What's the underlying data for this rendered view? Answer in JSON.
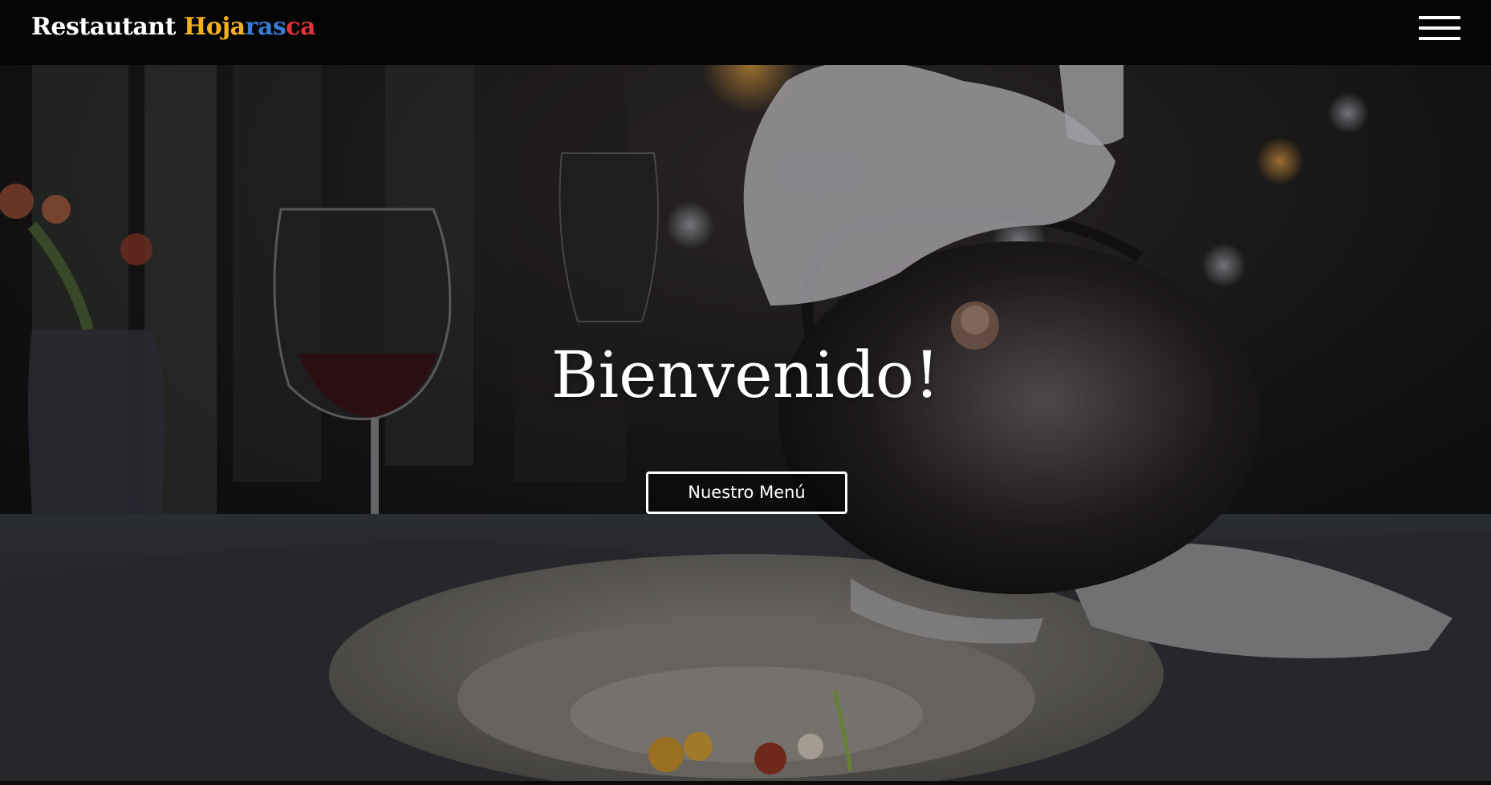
{
  "navbar": {
    "brand_word1": "Restautant",
    "brand_word2_letters": [
      {
        "char": "H",
        "color": "#f2b01e"
      },
      {
        "char": "o",
        "color": "#f2b01e"
      },
      {
        "char": "j",
        "color": "#f2b01e"
      },
      {
        "char": "a",
        "color": "#f2b01e"
      },
      {
        "char": "r",
        "color": "#3a7bd5"
      },
      {
        "char": "a",
        "color": "#3a7bd5"
      },
      {
        "char": "s",
        "color": "#3a7bd5"
      },
      {
        "char": "c",
        "color": "#e0333a"
      },
      {
        "char": "a",
        "color": "#e0333a"
      }
    ],
    "menu_icon": "hamburger-menu-icon"
  },
  "hero": {
    "title": "Bienvenido!",
    "button_label": "Nuestro Menú",
    "background": "restaurant-tea-pouring-photo"
  },
  "colors": {
    "navbar_bg": "#050505",
    "text": "#ffffff",
    "brand_yellow": "#f2b01e",
    "brand_blue": "#3a7bd5",
    "brand_red": "#e0333a"
  }
}
